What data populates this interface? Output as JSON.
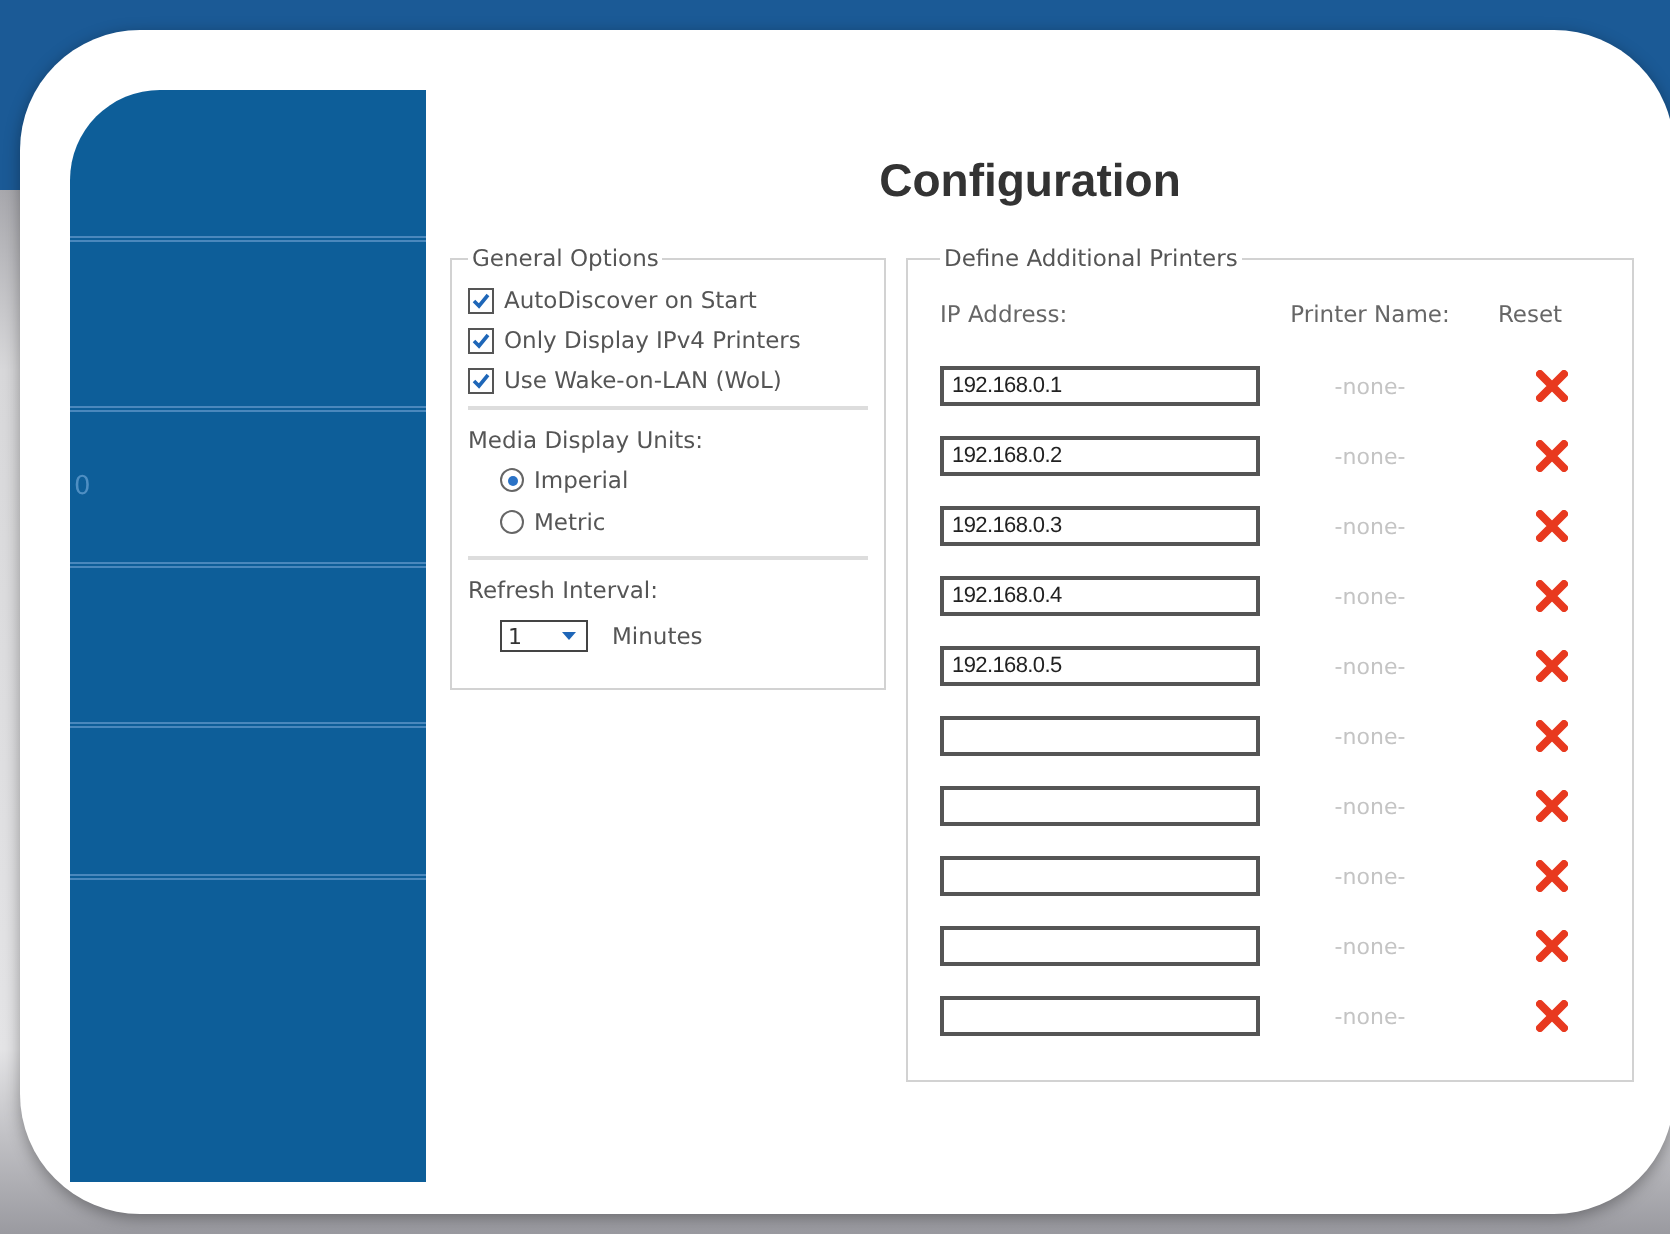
{
  "title": "Configuration",
  "sidebar": {
    "item_text": "0"
  },
  "general_options": {
    "title": "General Options",
    "checkboxes": [
      {
        "label": "AutoDiscover on Start",
        "checked": true
      },
      {
        "label": "Only Display IPv4 Printers",
        "checked": true
      },
      {
        "label": "Use Wake-on-LAN (WoL)",
        "checked": true
      }
    ],
    "media_units": {
      "label": "Media Display Units:",
      "options": [
        {
          "label": "Imperial",
          "selected": true
        },
        {
          "label": "Metric",
          "selected": false
        }
      ]
    },
    "refresh": {
      "label": "Refresh Interval:",
      "value": "1",
      "unit": "Minutes"
    }
  },
  "printers": {
    "title": "Define Additional Printers",
    "columns": [
      "IP Address:",
      "Printer Name:",
      "Reset"
    ],
    "rows": [
      {
        "ip": "192.168.0.1",
        "name": "-none-"
      },
      {
        "ip": "192.168.0.2",
        "name": "-none-"
      },
      {
        "ip": "192.168.0.3",
        "name": "-none-"
      },
      {
        "ip": "192.168.0.4",
        "name": "-none-"
      },
      {
        "ip": "192.168.0.5",
        "name": "-none-"
      },
      {
        "name": "-none-"
      },
      {
        "name": "-none-"
      },
      {
        "name": "-none-"
      },
      {
        "name": "-none-"
      },
      {
        "name": "-none-"
      }
    ]
  }
}
